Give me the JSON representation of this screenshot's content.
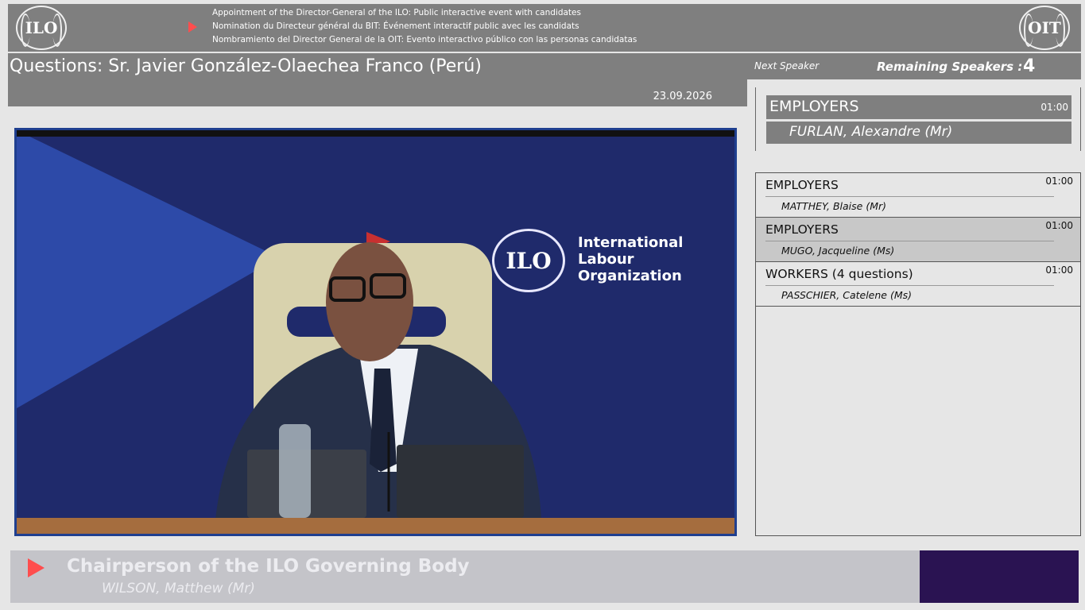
{
  "header": {
    "logo_left": "ILO",
    "logo_right": "OIT",
    "lines": [
      "Appointment of the Director-General of the ILO: Public interactive event with candidates",
      "Nomination du Directeur général du BIT: Événement interactif public avec les candidats",
      "Nombramiento del Director General de la OIT: Evento interactivo público con las personas candidatas"
    ]
  },
  "title": {
    "text": "Questions: Sr. Javier González-Olaechea Franco (Perú)",
    "date": "23.09.2026"
  },
  "right_head": {
    "next_label": "Next Speaker",
    "remaining_label": "Remaining Speakers :",
    "remaining_count": "4"
  },
  "next_speaker": {
    "group": "EMPLOYERS",
    "time": "01:00",
    "person": "FURLAN, Alexandre (Mr)"
  },
  "speakers": [
    {
      "group": "EMPLOYERS",
      "time": "01:00",
      "person": "MATTHEY, Blaise (Mr)"
    },
    {
      "group": "EMPLOYERS",
      "time": "01:00",
      "person": "MUGO, Jacqueline (Ms)"
    },
    {
      "group": "WORKERS  (4 questions)",
      "time": "01:00",
      "person": "PASSCHIER, Catelene (Ms)"
    }
  ],
  "video": {
    "emblem": "ILO",
    "brand_lines": [
      "International",
      "Labour",
      "Organization"
    ]
  },
  "caption": {
    "role": "Chairperson of the ILO Governing Body",
    "person": "WILSON, Matthew (Mr)"
  },
  "colors": {
    "panel_gray": "#7f7f7f",
    "accent_red": "#ff4d4d",
    "video_blue": "#1f2a6b",
    "purple": "#2a1352"
  }
}
